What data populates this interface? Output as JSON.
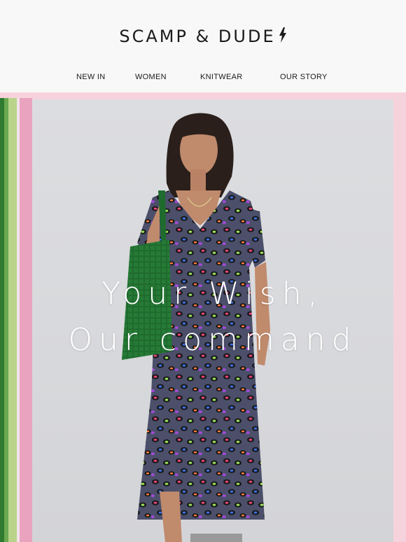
{
  "brand": {
    "name": "SCAMP & DUDE",
    "logo_icon": "lightning-bolt-icon"
  },
  "nav": {
    "items": [
      "NEW IN",
      "WOMEN",
      "KNITWEAR",
      "OUR STORY"
    ]
  },
  "hero": {
    "headline_line1": "Your Wish,",
    "headline_line2": "Our command",
    "colors": {
      "frame_pink": "#f6d3dc",
      "stripe_green": "#3f8a36",
      "stripe_lime": "#b7d27c",
      "stripe_pink": "#e9a3bf",
      "bag_green": "#1f6b2e"
    }
  }
}
